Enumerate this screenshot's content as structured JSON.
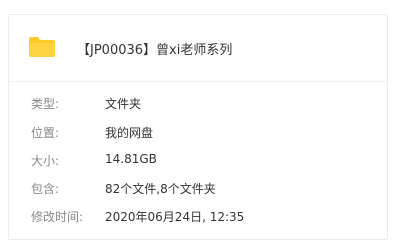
{
  "header": {
    "title": "【JP00036】曾xi老师系列",
    "icon": "folder-icon",
    "icon_color": "#FFC928"
  },
  "details": [
    {
      "label": "类型:",
      "value": "文件夹"
    },
    {
      "label": "位置:",
      "value": "我的网盘"
    },
    {
      "label": "大小:",
      "value": "14.81GB"
    },
    {
      "label": "包含:",
      "value": "82个文件,8个文件夹"
    },
    {
      "label": "修改时间:",
      "value": "2020年06月24日, 12:35"
    }
  ]
}
